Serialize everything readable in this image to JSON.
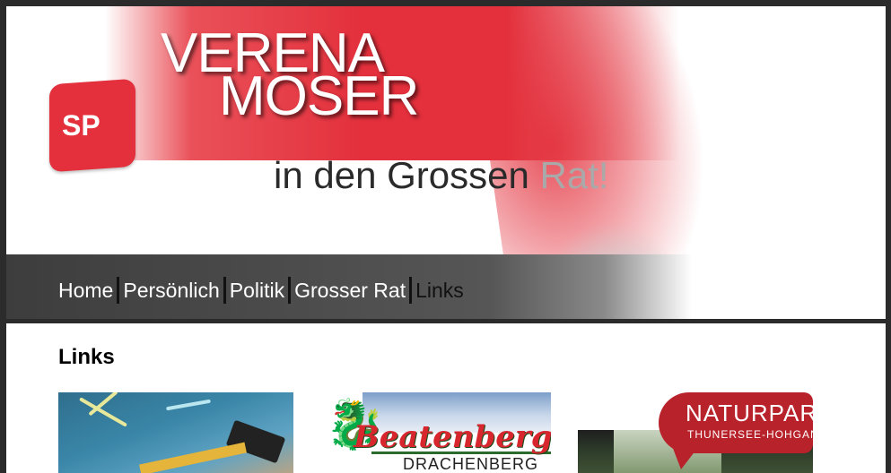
{
  "header": {
    "logo_text": "SP",
    "name_line1": "VERENA",
    "name_line2": "MOSER",
    "slogan_main": "in den Grossen ",
    "slogan_faded": "Rat!"
  },
  "nav": {
    "items": [
      {
        "label": "Home"
      },
      {
        "label": "Persönlich"
      },
      {
        "label": "Politik"
      },
      {
        "label": "Grosser Rat"
      },
      {
        "label": "Links"
      }
    ],
    "active": "Links"
  },
  "content": {
    "title": "Links",
    "links": [
      {
        "icon": "school-chalkboard-image"
      },
      {
        "icon": "beatenberg-logo",
        "brand": "Beatenberg",
        "subtitle": "DRACHENBERG"
      },
      {
        "icon": "naturpark-logo",
        "brand": "NATURPARK",
        "subtitle": "THUNERSEE-HOHGANT"
      }
    ]
  },
  "colors": {
    "accent": "#e3303c",
    "nav_bg": "#4a4a4a",
    "frame_bg": "#2b2b2b"
  }
}
